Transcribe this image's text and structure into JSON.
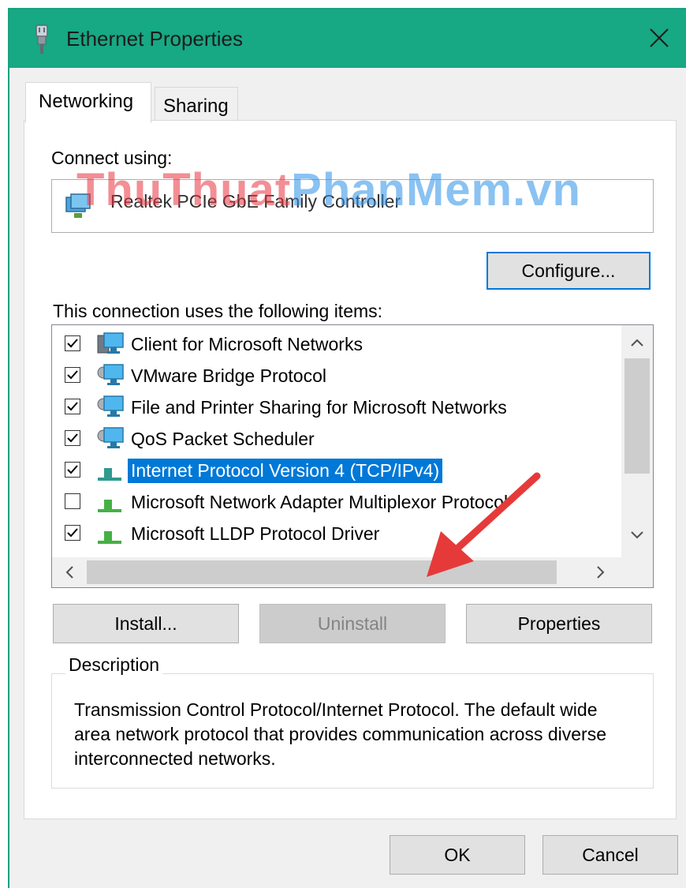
{
  "window": {
    "title": "Ethernet Properties",
    "accent_color": "#17a884",
    "icon": "ethernet-plug-icon"
  },
  "tabs": [
    {
      "label": "Networking",
      "selected": true
    },
    {
      "label": "Sharing",
      "selected": false
    }
  ],
  "connect": {
    "label": "Connect using:",
    "adapter": "Realtek PCIe GbE Family Controller",
    "configure_label": "Configure..."
  },
  "watermark": {
    "part1": "ThuThuat",
    "part2": "PhanMem",
    "part3": ".vn"
  },
  "items": {
    "label": "This connection uses the following items:",
    "list": [
      {
        "label": "Client for Microsoft Networks",
        "checked": true,
        "icon": "network-client-icon"
      },
      {
        "label": "VMware Bridge Protocol",
        "checked": true,
        "icon": "network-service-icon"
      },
      {
        "label": "File and Printer Sharing for Microsoft Networks",
        "checked": true,
        "icon": "network-service-icon"
      },
      {
        "label": "QoS Packet Scheduler",
        "checked": true,
        "icon": "network-service-icon"
      },
      {
        "label": "Internet Protocol Version 4 (TCP/IPv4)",
        "checked": true,
        "selected": true,
        "icon": "protocol-icon"
      },
      {
        "label": "Microsoft Network Adapter Multiplexor Protocol",
        "checked": false,
        "icon": "protocol-icon"
      },
      {
        "label": "Microsoft LLDP Protocol Driver",
        "checked": true,
        "icon": "protocol-icon"
      }
    ]
  },
  "buttons": {
    "install": "Install...",
    "uninstall": "Uninstall",
    "properties": "Properties",
    "ok": "OK",
    "cancel": "Cancel"
  },
  "description": {
    "title": "Description",
    "text": "Transmission Control Protocol/Internet Protocol. The default wide area network protocol that provides communication across diverse interconnected networks."
  }
}
